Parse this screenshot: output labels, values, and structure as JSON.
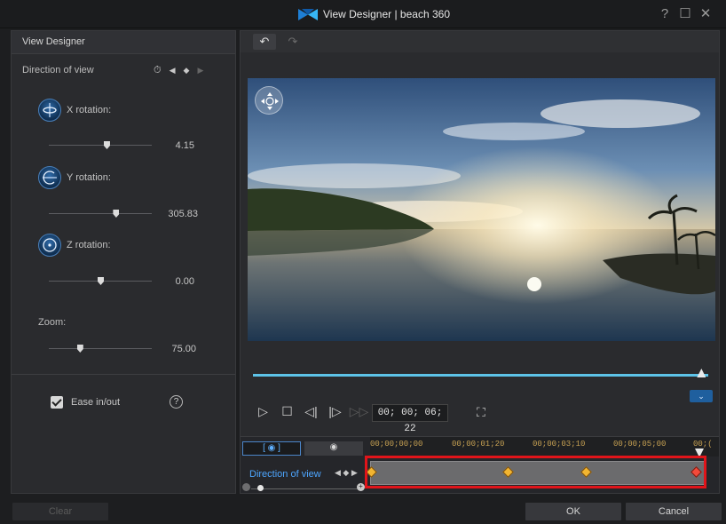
{
  "window": {
    "title": "View Designer  |  beach 360",
    "help_glyph": "?",
    "maximize_glyph": "☐",
    "close_glyph": "✕"
  },
  "left_panel": {
    "header": "View Designer",
    "section_title": "Direction of view",
    "x_rotation": {
      "label": "X rotation:",
      "value": "4.15",
      "level": 0.56
    },
    "y_rotation": {
      "label": "Y rotation:",
      "value": "305.83",
      "level": 0.65
    },
    "z_rotation": {
      "label": "Z rotation:",
      "value": "0.00",
      "level": 0.5
    },
    "zoom": {
      "label": "Zoom:",
      "value": "75.00",
      "level": 0.3
    },
    "ease": {
      "label": "Ease in/out",
      "checked": true
    },
    "help_glyph": "?"
  },
  "toolbar": {
    "undo_glyph": "↶",
    "redo_glyph": "↷"
  },
  "player": {
    "progress": 0.985,
    "timecode": "00; 00; 06; 22",
    "expand_glyph": "⌄"
  },
  "timeline": {
    "tab_active": "[ ◉ ]",
    "tab_inactive": "◉",
    "ruler_labels": [
      "00;00;00;00",
      "00;00;01;20",
      "00;00;03;10",
      "00;00;05;00",
      "00;("
    ],
    "track_label": "Direction of view",
    "track_nav": "◀ ◆ ▶",
    "zoom_plus": "+"
  },
  "buttons": {
    "clear": "Clear",
    "ok": "OK",
    "cancel": "Cancel"
  },
  "colors": {
    "accent_blue": "#5dc3e8",
    "keyframe": "#f2b531",
    "keyframe_current": "#f24a3a",
    "highlight": "#e0141a",
    "timecode_ruler": "#c6a052"
  }
}
